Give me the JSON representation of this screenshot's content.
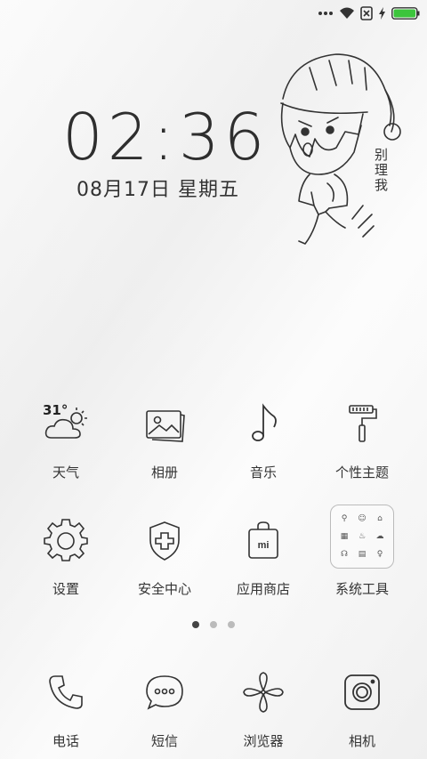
{
  "status_bar": {
    "icons": [
      "more-dots-icon",
      "wifi-icon",
      "no-sim-icon",
      "charging-icon",
      "battery-icon"
    ],
    "battery_color": "#3cc53c"
  },
  "lockscreen": {
    "time": "02:36",
    "date": "08月17日 星期五"
  },
  "doodle": {
    "text": "别理我"
  },
  "weather": {
    "temperature": "31°"
  },
  "apps_row1": [
    {
      "label": "天气",
      "icon": "weather-icon"
    },
    {
      "label": "相册",
      "icon": "gallery-icon"
    },
    {
      "label": "音乐",
      "icon": "music-icon"
    },
    {
      "label": "个性主题",
      "icon": "theme-roller-icon"
    }
  ],
  "apps_row2": [
    {
      "label": "设置",
      "icon": "settings-gear-icon"
    },
    {
      "label": "安全中心",
      "icon": "security-shield-icon"
    },
    {
      "label": "应用商店",
      "icon": "app-store-bag-icon"
    },
    {
      "label": "系统工具",
      "icon": "system-tools-folder-icon"
    }
  ],
  "page_indicator": {
    "count": 3,
    "active": 0
  },
  "dock": [
    {
      "label": "电话",
      "icon": "phone-icon"
    },
    {
      "label": "短信",
      "icon": "messages-icon"
    },
    {
      "label": "浏览器",
      "icon": "browser-icon"
    },
    {
      "label": "相机",
      "icon": "camera-icon"
    }
  ],
  "app_store_badge": "mi"
}
